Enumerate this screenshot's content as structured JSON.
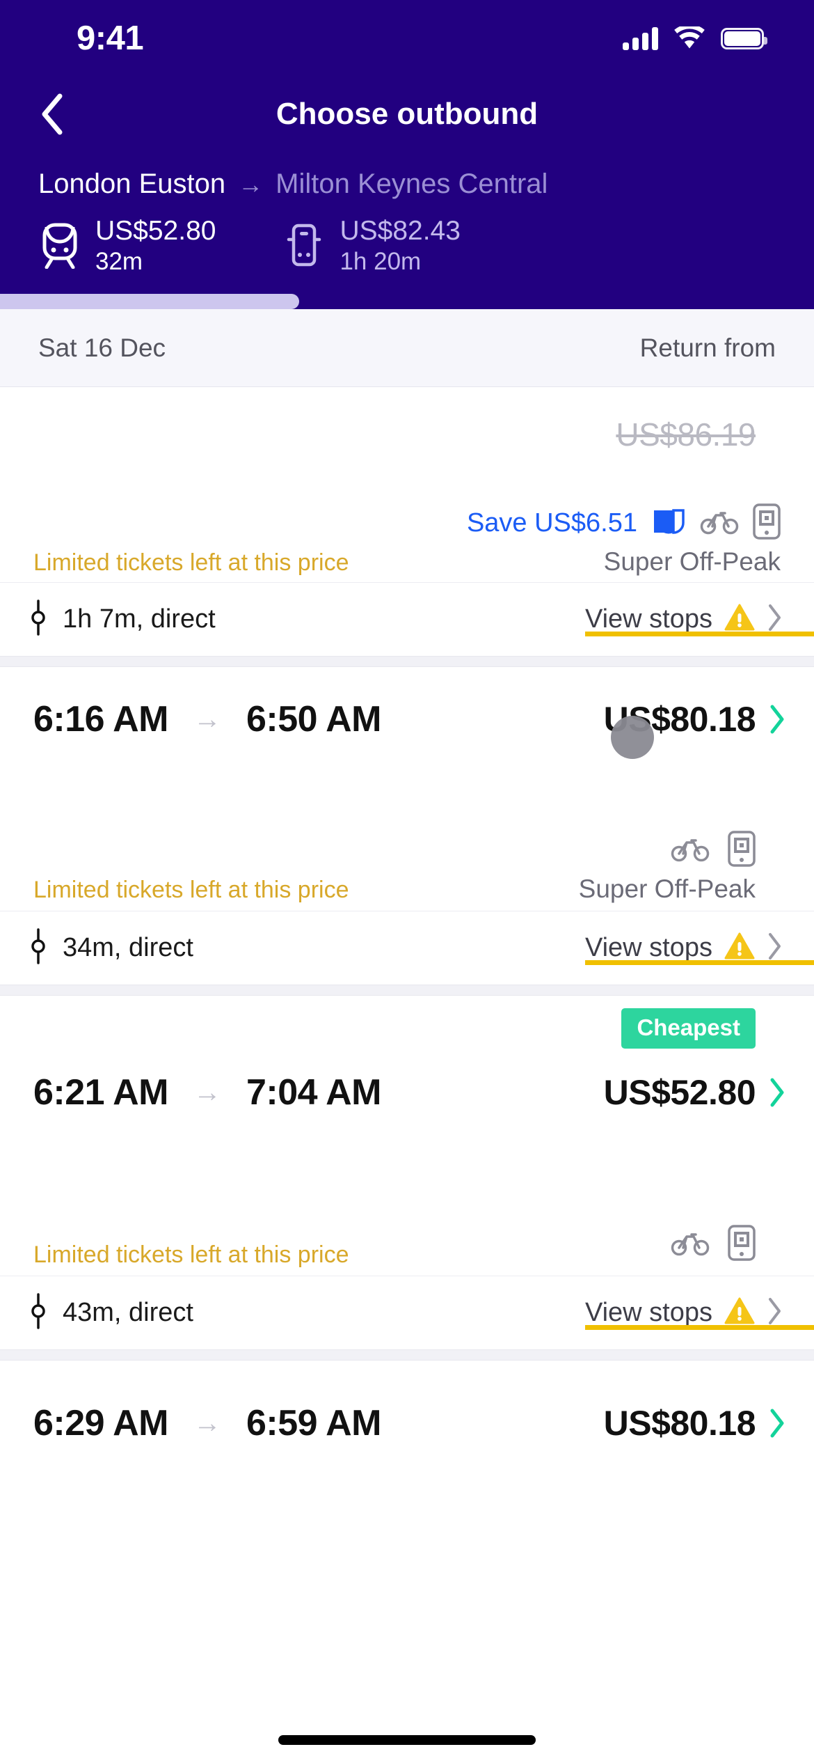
{
  "status_bar": {
    "time": "9:41",
    "signal_icon": "cellular-signal-icon",
    "wifi_icon": "wifi-icon",
    "battery_icon": "battery-icon"
  },
  "nav": {
    "back_icon": "chevron-left-icon",
    "title": "Choose outbound"
  },
  "route": {
    "origin": "London Euston",
    "arrow": "→",
    "destination": "Milton Keynes Central"
  },
  "modes": [
    {
      "icon": "train-icon",
      "price": "US$52.80",
      "duration": "32m",
      "selected": true
    },
    {
      "icon": "bus-icon",
      "price": "US$82.43",
      "duration": "1h 20m",
      "selected": false
    }
  ],
  "date_bar": {
    "date": "Sat 16 Dec",
    "return_label": "Return from"
  },
  "results": [
    {
      "depart": "",
      "arrive": "",
      "price": "",
      "old_price": "US$86.19",
      "partial": true,
      "save_text": "Save US$6.51",
      "save_icon": "split-ticket-icon",
      "perks": [
        "bicycle-icon",
        "mobile-ticket-icon"
      ],
      "limited_text": "Limited tickets left at this price",
      "fare_label": "Super Off-Peak",
      "duration": "1h 7m, direct",
      "stops_label": "View stops",
      "warning_icon": "warning-triangle-icon",
      "chevron_icon": "chevron-right-icon"
    },
    {
      "depart": "6:16 AM",
      "arrive": "6:50 AM",
      "price": "US$80.18",
      "badge": "",
      "perks": [
        "bicycle-icon",
        "mobile-ticket-icon"
      ],
      "limited_text": "Limited tickets left at this price",
      "fare_label": "Super Off-Peak",
      "duration": "34m, direct",
      "stops_label": "View stops",
      "warning_icon": "warning-triangle-icon",
      "chevron_icon": "chevron-right-icon"
    },
    {
      "depart": "6:21 AM",
      "arrive": "7:04 AM",
      "price": "US$52.80",
      "badge": "Cheapest",
      "perks": [
        "bicycle-icon",
        "mobile-ticket-icon"
      ],
      "limited_text": "Limited tickets left at this price",
      "fare_label": "",
      "duration": "43m, direct",
      "stops_label": "View stops",
      "warning_icon": "warning-triangle-icon",
      "chevron_icon": "chevron-right-icon"
    },
    {
      "depart": "6:29 AM",
      "arrive": "6:59 AM",
      "price": "US$80.18",
      "badge": "",
      "perks": [],
      "limited_text": "",
      "fare_label": "",
      "duration": "",
      "stops_label": "",
      "warning_icon": "",
      "chevron_icon": "chevron-right-icon"
    }
  ],
  "colors": {
    "header_bg": "#220080",
    "accent_blue": "#1b5cf5",
    "warn_amber": "#d8a82a",
    "underline_yellow": "#f0c000",
    "cheapest_green": "#2dd59e",
    "chevron_green": "#13d39a",
    "muted_purple": "#9b8fd4"
  },
  "arrow_glyph": "→"
}
